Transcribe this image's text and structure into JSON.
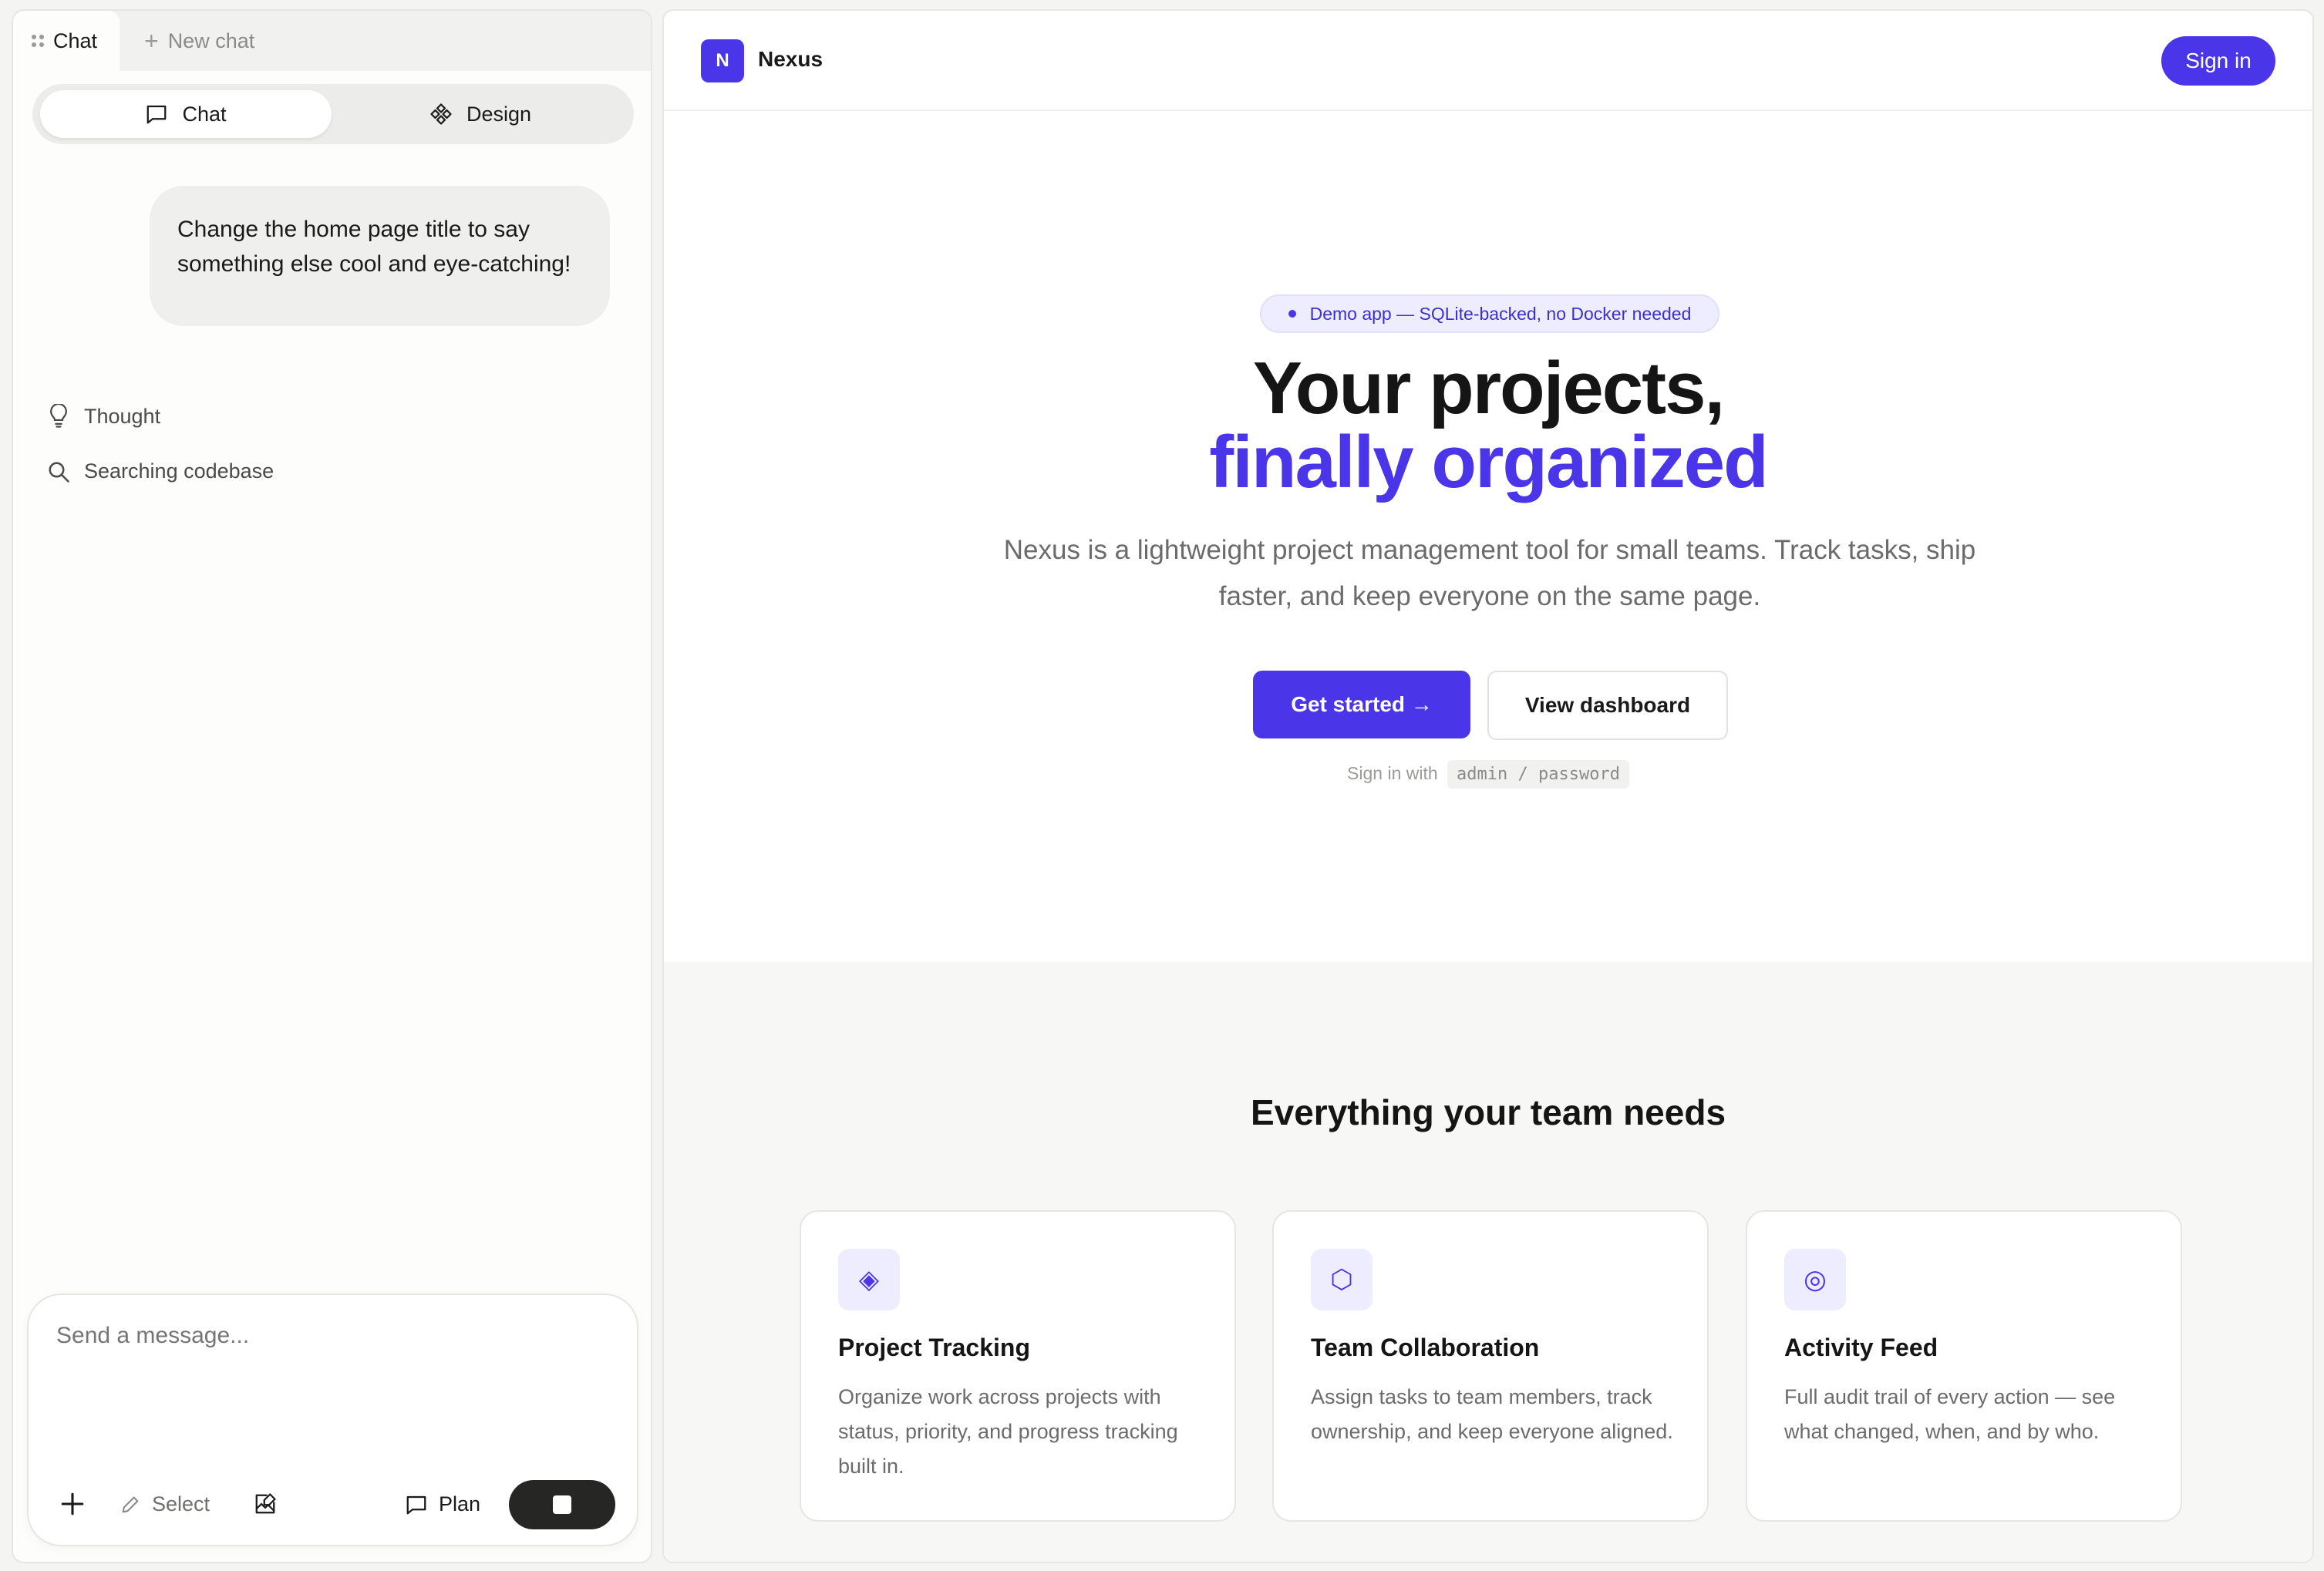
{
  "left_panel": {
    "tabs": [
      {
        "label": "Chat",
        "icon": "grip-icon",
        "active": true
      },
      {
        "label": "New chat",
        "icon": "plus-icon",
        "active": false
      }
    ],
    "mode_toggle": {
      "chat_label": "Chat",
      "design_label": "Design",
      "selected": "Chat"
    },
    "user_message": "Change the home page title to say something else cool and eye-catching!",
    "status_items": [
      {
        "label": "Thought",
        "icon": "lightbulb-icon"
      },
      {
        "label": "Searching codebase",
        "icon": "search-icon"
      }
    ],
    "composer": {
      "placeholder": "Send a message...",
      "add_icon": "plus-icon",
      "select_label": "Select",
      "plan_label": "Plan",
      "stop_icon": "stop-icon"
    }
  },
  "app": {
    "brand_initial": "N",
    "brand_name": "Nexus",
    "sign_in_label": "Sign in",
    "accent_color": "#4a36e8",
    "hero": {
      "badge": "Demo app — SQLite-backed, no Docker needed",
      "title_line1": "Your projects,",
      "title_line2": "finally organized",
      "lead_line1": "Nexus is a lightweight project management tool for small teams. Track tasks, ship",
      "lead_line2": "faster, and keep everyone on the same page.",
      "primary_cta": "Get started →",
      "secondary_cta": "View dashboard",
      "hint_prefix": "Sign in with",
      "hint_code": "admin / password"
    },
    "features": {
      "title": "Everything your team needs",
      "cards": [
        {
          "icon": "diamond-icon",
          "glyph": "◈",
          "title": "Project Tracking",
          "description": "Organize work across projects with status, priority, and progress tracking built in."
        },
        {
          "icon": "hexagon-icon",
          "glyph": "⬡",
          "title": "Team Collaboration",
          "description": "Assign tasks to team members, track ownership, and keep everyone aligned."
        },
        {
          "icon": "target-icon",
          "glyph": "◎",
          "title": "Activity Feed",
          "description": "Full audit trail of every action — see what changed, when, and by who."
        }
      ]
    }
  }
}
